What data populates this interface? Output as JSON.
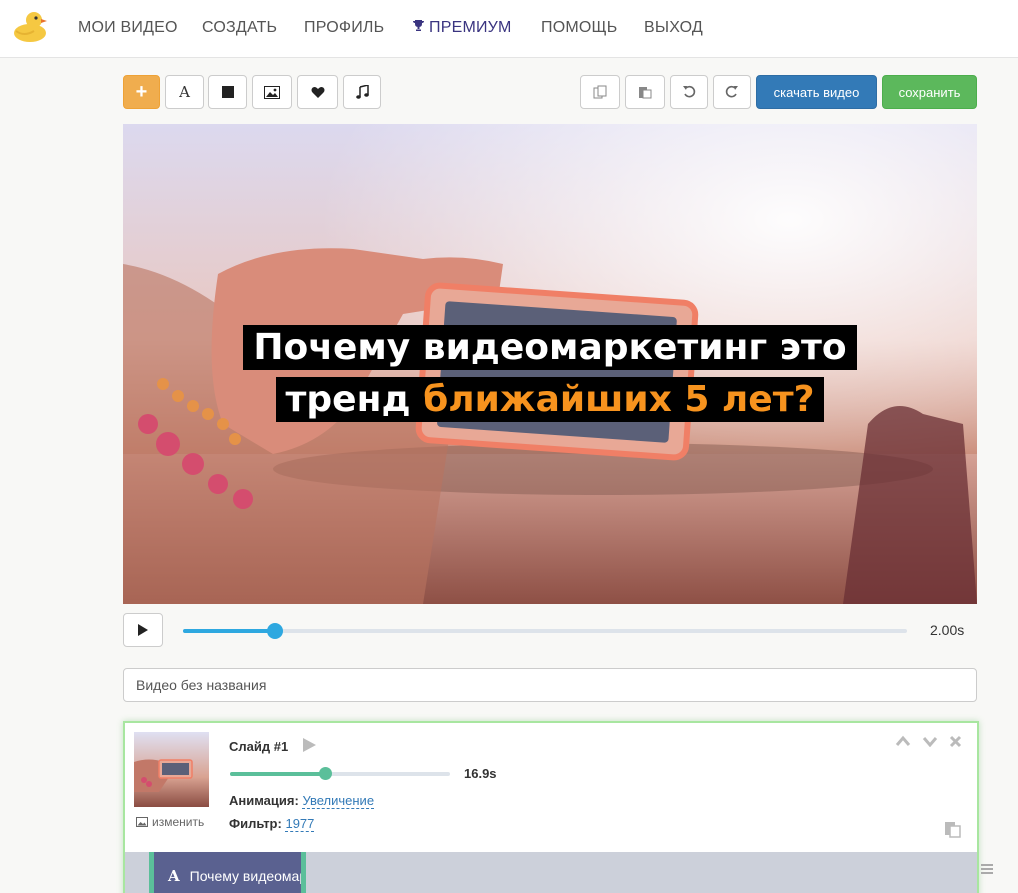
{
  "nav": {
    "items": [
      "МОИ ВИДЕО",
      "СОЗДАТЬ",
      "ПРОФИЛЬ",
      "ПРЕМИУМ",
      "ПОМОЩЬ",
      "ВЫХОД"
    ]
  },
  "toolbar": {
    "add_label": "+",
    "text_tool_label": "A",
    "download_label": "скачать видео",
    "save_label": "сохранить"
  },
  "caption": {
    "line1": "Почему видеомаркетинг это",
    "line2_plain": "тренд ",
    "line2_highlight": "ближайших 5 лет?"
  },
  "player": {
    "progress": 0.127,
    "time": "2.00s"
  },
  "video_title": {
    "value": "Видео без названия"
  },
  "slide": {
    "title": "Слайд #1",
    "duration": "16.9s",
    "duration_progress": 0.43,
    "change_label": "изменить",
    "animation_label": "Анимация:",
    "animation_value": "Увеличение",
    "filter_label": "Фильтр:",
    "filter_value": "1977",
    "layer_icon": "A",
    "layer_text": "Почему видеомаркетинг"
  },
  "colors": {
    "accent_orange": "#f7931e",
    "download_blue": "#337ab7",
    "save_green": "#5cb85c",
    "progress_blue": "#2ea8e0",
    "slide_green": "#5bbf9a",
    "premium": "#3a3480"
  },
  "icons": [
    "duck-logo",
    "trophy-icon",
    "text-icon",
    "square-icon",
    "image-icon",
    "heart-icon",
    "music-icon",
    "copy-icon",
    "paste-icon",
    "undo-icon",
    "redo-icon",
    "play-icon",
    "chevron-up-icon",
    "chevron-down-icon",
    "close-icon",
    "drag-handle-icon"
  ]
}
